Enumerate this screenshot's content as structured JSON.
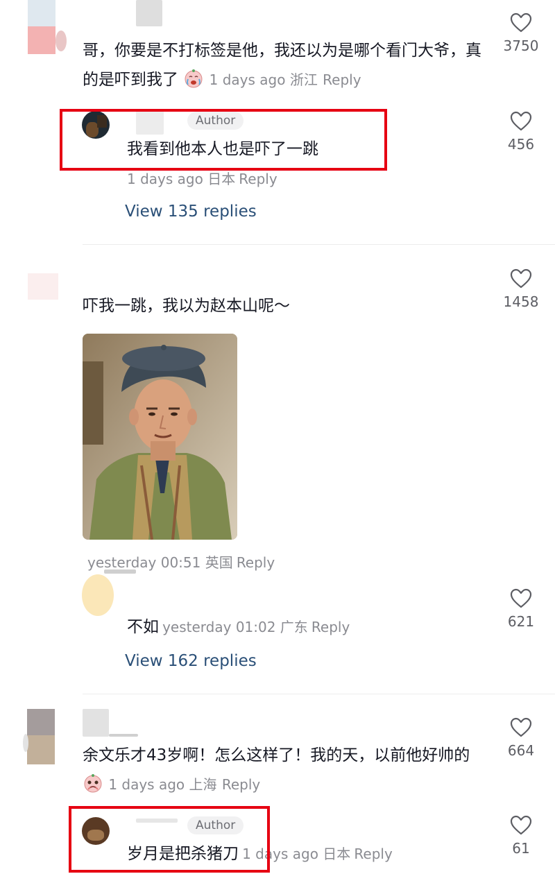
{
  "comments": [
    {
      "text": "哥，你要是不打标签是他，我还以为是哪个看门大爷，真的是吓到我了",
      "emoji": "crying-face",
      "meta": "1 days ago 浙江",
      "reply_label": "Reply",
      "likes": "3750"
    },
    {
      "badge": "Author",
      "text": "我看到他本人也是吓了一跳",
      "meta": "1 days ago 日本",
      "reply_label": "Reply",
      "likes": "456",
      "view_replies": "View 135 replies"
    },
    {
      "text": "吓我一跳，我以为赵本山呢～",
      "meta": "yesterday 00:51 英国",
      "reply_label": "Reply",
      "likes": "1458",
      "image": "photo-of-older-man-in-beret"
    },
    {
      "text": "不如",
      "meta": "yesterday 01:02 广东",
      "reply_label": "Reply",
      "likes": "621",
      "view_replies": "View 162 replies"
    },
    {
      "text": "余文乐才43岁啊！怎么这样了！我的天，以前他好帅的",
      "emoji": "pleading-face",
      "meta": "1 days ago 上海",
      "reply_label": "Reply",
      "likes": "664"
    },
    {
      "badge": "Author",
      "text": "岁月是把杀猪刀",
      "meta": "1 days ago 日本",
      "reply_label": "Reply",
      "likes": "61"
    }
  ],
  "colors": {
    "highlight": "#e60012",
    "link": "#2a4f77",
    "meta": "#8a8b91"
  },
  "icons": {
    "like": "heart-outline-icon"
  }
}
